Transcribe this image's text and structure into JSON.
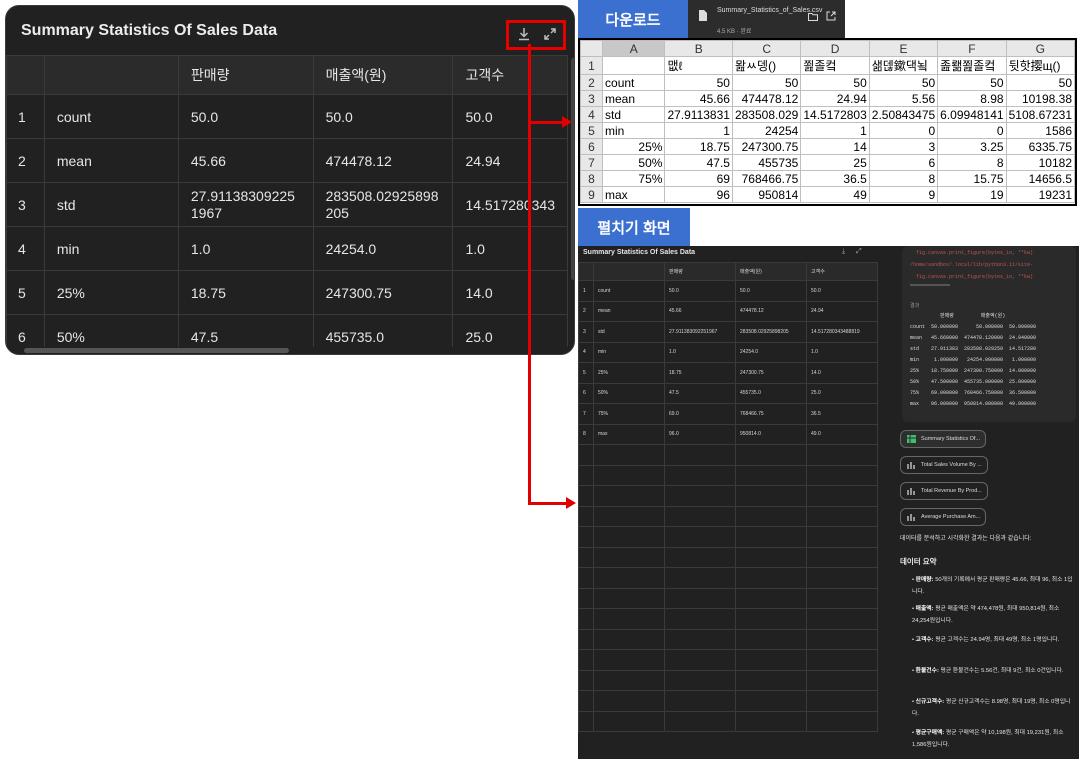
{
  "main": {
    "title": "Summary Statistics Of Sales Data",
    "headers": [
      "",
      "",
      "판매량",
      "매출액(원)",
      "고객수"
    ],
    "rows": [
      [
        "1",
        "count",
        "50.0",
        "50.0",
        "50.0"
      ],
      [
        "2",
        "mean",
        "45.66",
        "474478.12",
        "24.94"
      ],
      [
        "3",
        "std",
        "27.911383092251967",
        "283508.02925898205",
        "14.517280343"
      ],
      [
        "4",
        "min",
        "1.0",
        "24254.0",
        "1.0"
      ],
      [
        "5",
        "25%",
        "18.75",
        "247300.75",
        "14.0"
      ],
      [
        "6",
        "50%",
        "47.5",
        "455735.0",
        "25.0"
      ]
    ]
  },
  "download": {
    "label": "다운로드",
    "filename": "Summary_Statistics_of_Sales.csv",
    "size": "4.5 KB · 완료"
  },
  "excel": {
    "col_headers": [
      "",
      "A",
      "B",
      "C",
      "D",
      "E",
      "F",
      "G"
    ],
    "rows": [
      [
        "1",
        "",
        "맶ℓ",
        "뫒ㅆ뎅()",
        "쬞졸컼",
        "샒덶鏉댁뇤",
        "졾뢞쬞졸컼",
        "뒷핫撄щ()"
      ],
      [
        "2",
        "count",
        "50",
        "50",
        "50",
        "50",
        "50",
        "50"
      ],
      [
        "3",
        "mean",
        "45.66",
        "474478.12",
        "24.94",
        "5.56",
        "8.98",
        "10198.38"
      ],
      [
        "4",
        "std",
        "27.9113831",
        "283508.029",
        "14.5172803",
        "2.50843475",
        "6.09948141",
        "5108.67231"
      ],
      [
        "5",
        "min",
        "1",
        "24254",
        "1",
        "0",
        "0",
        "1586"
      ],
      [
        "6",
        "25%",
        "18.75",
        "247300.75",
        "14",
        "3",
        "3.25",
        "6335.75"
      ],
      [
        "7",
        "50%",
        "47.5",
        "455735",
        "25",
        "6",
        "8",
        "10182"
      ],
      [
        "8",
        "75%",
        "69",
        "768466.75",
        "36.5",
        "8",
        "15.75",
        "14656.5"
      ],
      [
        "9",
        "max",
        "96",
        "950814",
        "49",
        "9",
        "19",
        "19231"
      ]
    ]
  },
  "expanded": {
    "label": "펼치기 화면",
    "title": "Summary Statistics Of Sales Data",
    "headers": [
      "",
      "",
      "판매량",
      "매출액(원)",
      "고객수"
    ],
    "rows": [
      [
        "1",
        "count",
        "50.0",
        "50.0",
        "50.0"
      ],
      [
        "2",
        "mean",
        "45.66",
        "474478.12",
        "24.94"
      ],
      [
        "3",
        "std",
        "27.911383092251967",
        "283508.02925898205",
        "14.517280343488819"
      ],
      [
        "4",
        "min",
        "1.0",
        "24254.0",
        "1.0"
      ],
      [
        "5",
        "25%",
        "18.75",
        "247300.75",
        "14.0"
      ],
      [
        "6",
        "50%",
        "47.5",
        "455735.0",
        "25.0"
      ],
      [
        "7",
        "75%",
        "69.0",
        "768466.75",
        "36.5"
      ],
      [
        "8",
        "max",
        "96.0",
        "950814.0",
        "49.0"
      ]
    ],
    "code_lines": [
      "  fig.canvas.print_figure(bytes_io, **kw)",
      "/home/sandbox/.local/lib/python3.11/site-",
      "  fig.canvas.print_figure(bytes_io, **kw)"
    ],
    "result_label": "결과",
    "result_header": "          판매량         매출액(원)",
    "result_rows": [
      "count  50.000000      50.000000  50.000000",
      "mean   45.660000  474478.120000  24.940000",
      "std    27.911383  283508.029259  14.517280",
      "min     1.000000   24254.000000   1.000000",
      "25%    18.750000  247300.750000  14.000000",
      "50%    47.500000  455735.000000  25.000000",
      "75%    69.000000  768466.750000  36.500000",
      "max    96.000000  950814.000000  49.000000"
    ],
    "chips": [
      "Summary Statistics Of...",
      "Total Sales Volume By ...",
      "Total Revenue By Prod...",
      "Average Purchase Am..."
    ],
    "intro": "데이터를 분석하고 시각화한 결과는 다음과 같습니다:",
    "summary_heading": "데이터 요약",
    "bullets": [
      {
        "b": "판매량:",
        "t": " 50개의 기록에서 평균 판매량은 45.66, 최대 96, 최소 1입니다."
      },
      {
        "b": "매출액:",
        "t": " 평균 매출액은 약 474,478원, 최대 950,814원, 최소 24,254원입니다."
      },
      {
        "b": "고객수:",
        "t": " 평균 고객수는 24.94명, 최대 49명, 최소 1명입니다."
      },
      {
        "b": "환불건수:",
        "t": " 평균 환불건수는 5.56건, 최대 9건, 최소 0건입니다."
      },
      {
        "b": "신규고객수:",
        "t": " 평균 신규고객수는 8.98명, 최대 19명, 최소 0명입니다."
      },
      {
        "b": "평균구매액:",
        "t": " 평균 구매액은 약 10,198원, 최대 19,231원, 최소 1,586원입니다."
      }
    ]
  },
  "colors": {
    "panel_bg": "#212121",
    "highlight_red": "#e00000",
    "label_blue": "#3b6fd0"
  }
}
